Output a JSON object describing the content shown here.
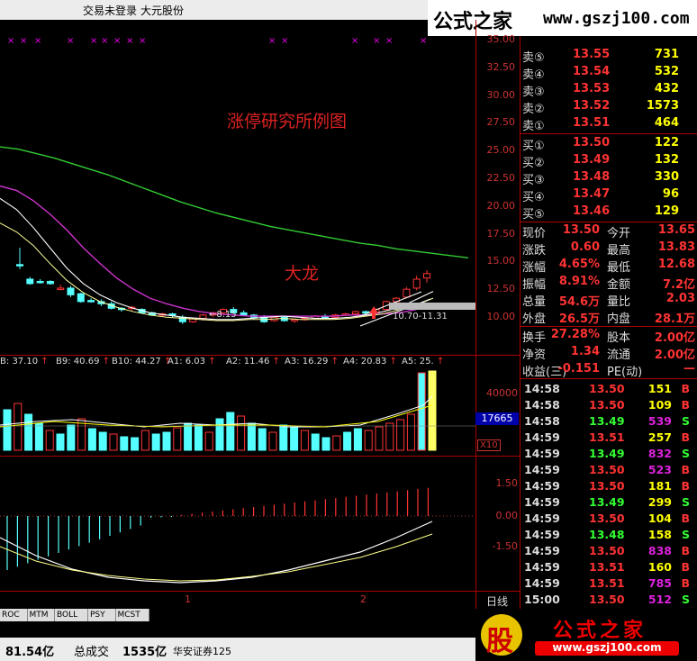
{
  "topbar": {
    "status": "交易未登录",
    "stock_name": "大元股份"
  },
  "watermark": {
    "title_cn": "公式之家",
    "url": "www.gszj100.com"
  },
  "chart_annotations": {
    "caption": "涨停研究所例图",
    "note": "大龙",
    "low_marker": "8.15",
    "range_marker": "10.70-11.31"
  },
  "chart_data": [
    {
      "type": "candlestick",
      "ylim": [
        8.5,
        35.0
      ],
      "y_ticks": [
        "35.00",
        "32.50",
        "30.00",
        "27.50",
        "25.00",
        "22.50",
        "20.00",
        "17.50",
        "15.00",
        "12.50",
        "10.00"
      ],
      "annotations": [
        "8.15",
        "10.70-11.31"
      ]
    },
    {
      "type": "bar",
      "y_ticks": [
        "40000"
      ],
      "current_value": "17665",
      "unit_label": "X10",
      "indicators": [
        {
          "name": "B",
          "value": "37.10"
        },
        {
          "name": "B9",
          "value": "40.69"
        },
        {
          "name": "B10",
          "value": "44.27"
        },
        {
          "name": "A1",
          "value": "6.03"
        },
        {
          "name": "A2",
          "value": "11.46"
        },
        {
          "name": "A3",
          "value": "16.29"
        },
        {
          "name": "A4",
          "value": "20.83"
        },
        {
          "name": "A5",
          "value": "25."
        }
      ]
    },
    {
      "type": "bar",
      "y_ticks": [
        "1.50",
        "0.00",
        "-1.50"
      ],
      "x_ticks": [
        "1",
        "2"
      ],
      "period": "日线"
    }
  ],
  "order_book": {
    "asks": [
      {
        "label": "卖⑤",
        "price": "13.55",
        "vol": "731"
      },
      {
        "label": "卖④",
        "price": "13.54",
        "vol": "532"
      },
      {
        "label": "卖③",
        "price": "13.53",
        "vol": "432"
      },
      {
        "label": "卖②",
        "price": "13.52",
        "vol": "1573"
      },
      {
        "label": "卖①",
        "price": "13.51",
        "vol": "464"
      }
    ],
    "bids": [
      {
        "label": "买①",
        "price": "13.50",
        "vol": "122"
      },
      {
        "label": "买②",
        "price": "13.49",
        "vol": "132"
      },
      {
        "label": "买③",
        "price": "13.48",
        "vol": "330"
      },
      {
        "label": "买④",
        "price": "13.47",
        "vol": "96"
      },
      {
        "label": "买⑤",
        "price": "13.46",
        "vol": "129"
      }
    ]
  },
  "stats": [
    {
      "k1": "现价",
      "v1": "13.50",
      "k2": "今开",
      "v2": "13.65"
    },
    {
      "k1": "涨跌",
      "v1": "0.60",
      "k2": "最高",
      "v2": "13.83"
    },
    {
      "k1": "涨幅",
      "v1": "4.65%",
      "k2": "最低",
      "v2": "12.68"
    },
    {
      "k1": "振幅",
      "v1": "8.91%",
      "k2": "金额",
      "v2": "7.2亿"
    },
    {
      "k1": "总量",
      "v1": "54.6万",
      "k2": "量比",
      "v2": "2.03"
    },
    {
      "k1": "外盘",
      "v1": "26.5万",
      "k2": "内盘",
      "v2": "28.1万"
    }
  ],
  "stats2": [
    {
      "k1": "换手",
      "v1": "27.28%",
      "k2": "股本",
      "v2": "2.00亿"
    },
    {
      "k1": "净资",
      "v1": "1.34",
      "k2": "流通",
      "v2": "2.00亿"
    },
    {
      "k1": "收益(三)",
      "v1": "-0.151",
      "k2": "PE(动)",
      "v2": "—"
    }
  ],
  "ticks": [
    {
      "time": "14:58",
      "price": "13.50",
      "vol": "151",
      "side": "B",
      "hl": false
    },
    {
      "time": "14:58",
      "price": "13.50",
      "vol": "109",
      "side": "B",
      "hl": false
    },
    {
      "time": "14:58",
      "price": "13.49",
      "vol": "539",
      "side": "S",
      "hl": true
    },
    {
      "time": "14:59",
      "price": "13.51",
      "vol": "257",
      "side": "B",
      "hl": false
    },
    {
      "time": "14:59",
      "price": "13.49",
      "vol": "832",
      "side": "S",
      "hl": true
    },
    {
      "time": "14:59",
      "price": "13.50",
      "vol": "523",
      "side": "B",
      "hl": true
    },
    {
      "time": "14:59",
      "price": "13.50",
      "vol": "181",
      "side": "B",
      "hl": false
    },
    {
      "time": "14:59",
      "price": "13.49",
      "vol": "299",
      "side": "S",
      "hl": false
    },
    {
      "time": "14:59",
      "price": "13.50",
      "vol": "104",
      "side": "B",
      "hl": false
    },
    {
      "time": "14:59",
      "price": "13.48",
      "vol": "158",
      "side": "S",
      "hl": false
    },
    {
      "time": "14:59",
      "price": "13.50",
      "vol": "838",
      "side": "B",
      "hl": true
    },
    {
      "time": "14:59",
      "price": "13.51",
      "vol": "160",
      "side": "B",
      "hl": false
    },
    {
      "time": "14:59",
      "price": "13.51",
      "vol": "785",
      "side": "B",
      "hl": true
    },
    {
      "time": "15:00",
      "price": "13.50",
      "vol": "512",
      "side": "S",
      "hl": true
    }
  ],
  "tabs": [
    "ROC",
    "MTM",
    "BOLL",
    "PSY",
    "MCST"
  ],
  "statusbar": {
    "left_value": "81.54亿",
    "total_label": "总成交",
    "total_value": "1535亿",
    "broker": "华安证券125"
  },
  "logo": {
    "glyph": "股",
    "title": "公式之家",
    "url": "www.gszj100.com"
  },
  "colors": {
    "up": "#ff3333",
    "down": "#55ffff",
    "ma_long": "#33cc33",
    "ma_mid": "#cc33cc",
    "ma_short": "#ffffff",
    "volume_label": "#ffff00"
  }
}
